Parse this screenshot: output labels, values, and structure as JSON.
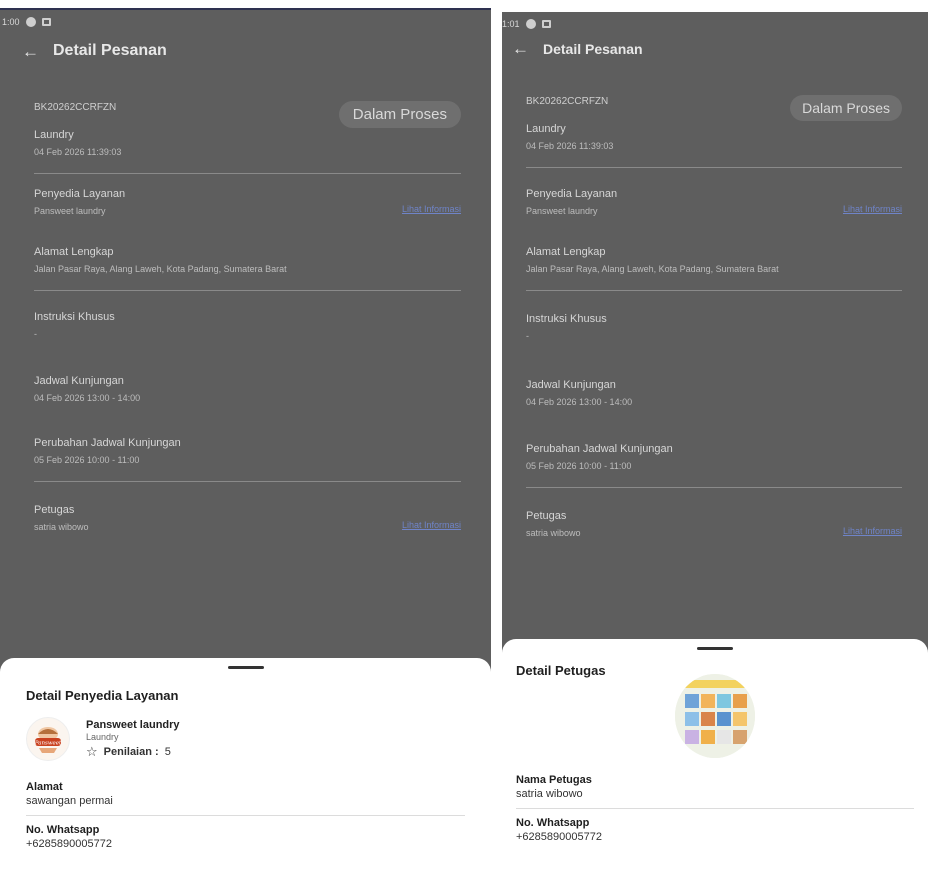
{
  "left": {
    "statusbar": {
      "time": "1:00"
    },
    "appbar": {
      "title": "Detail Pesanan"
    },
    "order": {
      "id": "BK20262CCRFZN",
      "status": "Dalam Proses",
      "service": "Laundry",
      "datetime": "04 Feb 2026  11:39:03"
    },
    "provider_section": {
      "label": "Penyedia Layanan",
      "value": "Pansweet laundry",
      "link": "Lihat Informasi"
    },
    "address_section": {
      "label": "Alamat Lengkap",
      "value": "Jalan Pasar Raya, Alang Laweh, Kota Padang, Sumatera Barat"
    },
    "instructions_section": {
      "label": "Instruksi Khusus",
      "value": "-"
    },
    "schedule_section": {
      "label": "Jadwal Kunjungan",
      "value": "04 Feb 2026 13:00 - 14:00"
    },
    "reschedule_section": {
      "label": "Perubahan Jadwal Kunjungan",
      "value": "05 Feb 2026 10:00 - 11:00"
    },
    "staff_section": {
      "label": "Petugas",
      "value": "satria wibowo",
      "link": "Lihat Informasi"
    },
    "sheet": {
      "title": "Detail Penyedia Layanan",
      "provider_name": "Pansweet laundry",
      "provider_category": "Laundry",
      "rating_label": "Penilaian :",
      "rating_value": "5",
      "address_label": "Alamat",
      "address_value": "sawangan permai",
      "whatsapp_label": "No. Whatsapp",
      "whatsapp_value": "+6285890005772",
      "logo_text": "Pansweet"
    }
  },
  "right": {
    "statusbar": {
      "time": "1:01"
    },
    "appbar": {
      "title": "Detail Pesanan"
    },
    "order": {
      "id": "BK20262CCRFZN",
      "status": "Dalam Proses",
      "service": "Laundry",
      "datetime": "04 Feb 2026  11:39:03"
    },
    "provider_section": {
      "label": "Penyedia Layanan",
      "value": "Pansweet laundry",
      "link": "Lihat Informasi"
    },
    "address_section": {
      "label": "Alamat Lengkap",
      "value": "Jalan Pasar Raya, Alang Laweh, Kota Padang, Sumatera Barat"
    },
    "instructions_section": {
      "label": "Instruksi Khusus",
      "value": "-"
    },
    "schedule_section": {
      "label": "Jadwal Kunjungan",
      "value": "04 Feb 2026 13:00 - 14:00"
    },
    "reschedule_section": {
      "label": "Perubahan Jadwal Kunjungan",
      "value": "05 Feb 2026 10:00 - 11:00"
    },
    "staff_section": {
      "label": "Petugas",
      "value": "satria wibowo",
      "link": "Lihat Informasi"
    },
    "sheet": {
      "title": "Detail Petugas",
      "name_label": "Nama Petugas",
      "name_value": "satria wibowo",
      "whatsapp_label": "No. Whatsapp",
      "whatsapp_value": "+6285890005772"
    }
  },
  "icons": {
    "back": "arrow-left-icon",
    "star": "star-outline-icon"
  },
  "colors": {
    "overlay": "#5e5e5e",
    "link": "#6f84c8",
    "sheet": "#ffffff"
  }
}
